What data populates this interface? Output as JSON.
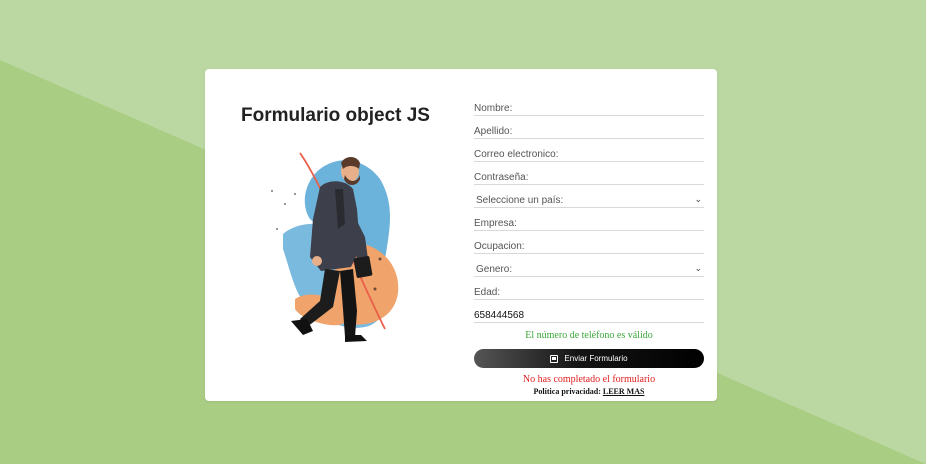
{
  "card": {
    "title": "Formulario object JS"
  },
  "form": {
    "fields": [
      {
        "label": "Nombre:"
      },
      {
        "label": "Apellido:"
      },
      {
        "label": "Correo electronico:"
      },
      {
        "label": "Contraseña:"
      },
      {
        "label": "Seleccione un país:"
      },
      {
        "label": "Empresa:"
      },
      {
        "label": "Ocupacion:"
      },
      {
        "label": "Genero:"
      },
      {
        "label": "Edad:"
      },
      {
        "value": "658444568"
      }
    ],
    "valid_message": "El número de teléfono es válido",
    "submit_label": "Enviar Formulario",
    "error_message": "No has completado el formulario",
    "policy_text": "Política privacidad:",
    "policy_link": "LEER MAS"
  },
  "colors": {
    "background": "#aacd84",
    "valid": "#3aa63a",
    "error": "#e02020"
  },
  "icons": {
    "submit": "form-icon",
    "select": "chevron-down-icon"
  }
}
